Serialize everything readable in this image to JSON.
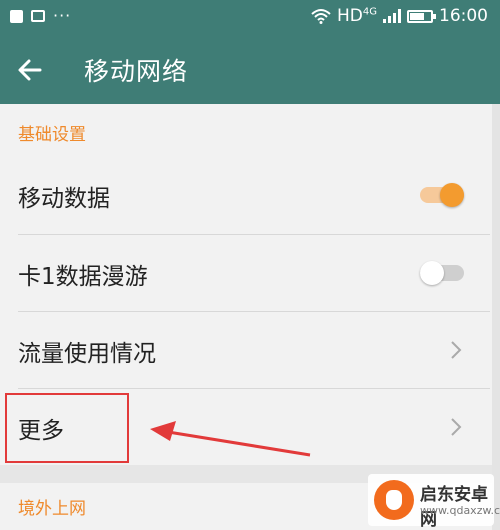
{
  "status_bar": {
    "network": "HD",
    "network_gen": "4G",
    "time": "16:00",
    "battery_level": 0.7,
    "icons": [
      "grid-icon",
      "image-icon",
      "more-dots-icon",
      "wifi-icon",
      "signal-icon",
      "battery-icon"
    ]
  },
  "toolbar": {
    "title": "移动网络",
    "back_icon": "arrow-left-icon"
  },
  "settings": {
    "section_basic": "基础设置",
    "items": [
      {
        "label": "移动数据",
        "control": "switch",
        "on": true
      },
      {
        "label": "卡1数据漫游",
        "control": "switch",
        "on": false
      },
      {
        "label": "流量使用情况",
        "control": "chevron"
      },
      {
        "label": "更多",
        "control": "chevron"
      }
    ],
    "section_overseas": "境外上网"
  },
  "annotation": {
    "highlight_color": "#e23a3a"
  },
  "watermark": {
    "title": "启东安卓网",
    "url": "www.qdaxzw.com"
  },
  "colors": {
    "toolbar": "#3f7d76",
    "accent": "#f39b2f",
    "section": "#ef8a2c"
  }
}
